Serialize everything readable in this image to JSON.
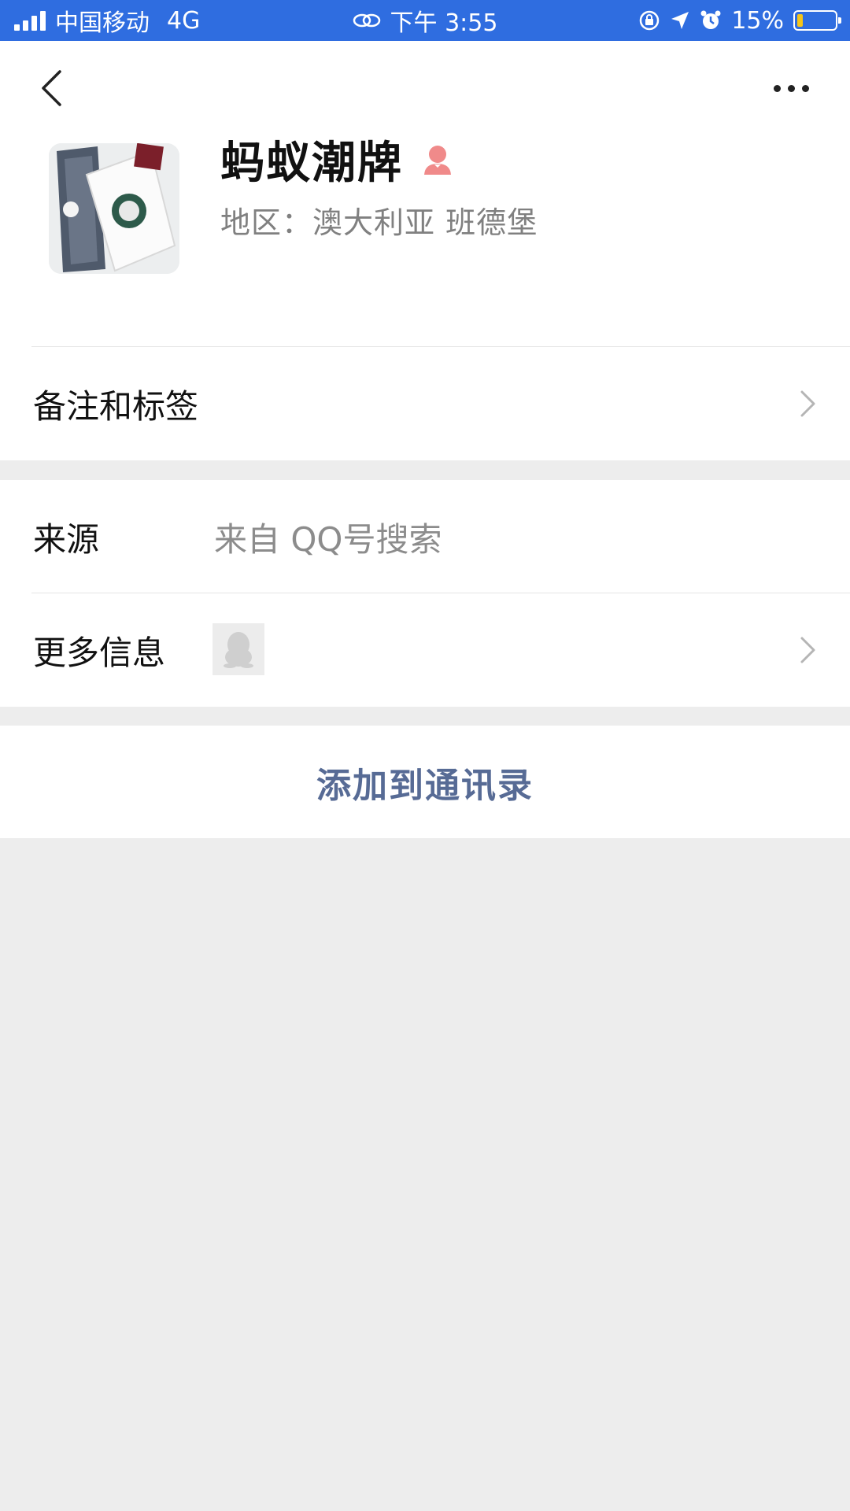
{
  "status_bar": {
    "carrier": "中国移动",
    "network": "4G",
    "time": "下午 3:55",
    "battery_percent": "15%",
    "battery_level": 0.15,
    "bg_color": "#2f6de0"
  },
  "nav": {
    "back_icon": "chevron-left-icon",
    "more_icon": "ellipsis-icon"
  },
  "profile": {
    "nickname": "蚂蚁潮牌",
    "gender_icon": "female-icon",
    "region": "地区：澳大利亚 班德堡"
  },
  "rows": {
    "remark_tags": {
      "label": "备注和标签"
    },
    "source": {
      "label": "来源",
      "value": "来自 QQ号搜索"
    },
    "more_info": {
      "label": "更多信息"
    }
  },
  "actions": {
    "add_contact": "添加到通讯录",
    "accent_color": "#576b95"
  }
}
